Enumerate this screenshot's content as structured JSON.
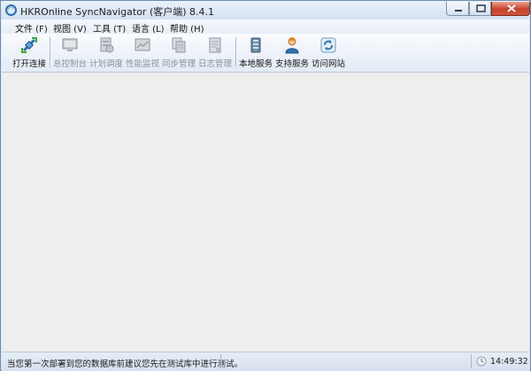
{
  "window": {
    "title": "HKROnline SyncNavigator (客户端) 8.4.1"
  },
  "menu": [
    {
      "label": "文件 (F)"
    },
    {
      "label": "视图 (V)"
    },
    {
      "label": "工具 (T)"
    },
    {
      "label": "语言 (L)"
    },
    {
      "label": "帮助 (H)"
    }
  ],
  "toolbar": {
    "open_connection": "打开连接",
    "console": "总控制台",
    "schedule": "计划调度",
    "performance": "性能监视",
    "sync_manage": "同步管理",
    "log_manage": "日志管理",
    "local_service": "本地服务",
    "support_service": "支持服务",
    "visit_website": "访问网站"
  },
  "icons": {
    "open_connection": "plug-arrows-icon",
    "console": "monitor-icon",
    "schedule": "calendar-icon",
    "performance": "chart-icon",
    "sync_manage": "sync-documents-icon",
    "log_manage": "log-file-icon",
    "local_service": "server-icon",
    "support_service": "support-person-icon",
    "visit_website": "refresh-globe-icon"
  },
  "status": {
    "message": "当您第一次部署到您的数据库前建议您先在测试库中进行测试。",
    "time": "14:49:32"
  },
  "colors": {
    "window_frame": "#6d8bb0",
    "close_button": "#c7432a",
    "content_bg": "#eeeeee"
  }
}
